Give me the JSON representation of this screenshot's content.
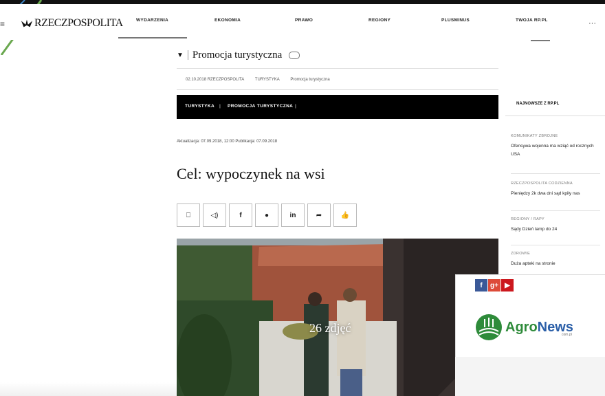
{
  "header": {
    "logo_text": "RZECZPOSPOLITA",
    "nav_items": [
      "WYDARZENIA",
      "EKONOMIA",
      "PRAWO",
      "REGIONY",
      "PLUSMINUS",
      "TWOJA RP.PL"
    ],
    "more_label": "···"
  },
  "article": {
    "section_title": "Promocja turystyczna",
    "breadcrumb": [
      "02.10.2018 RZECZPOSPOLITA",
      "TURYSTYKA",
      "Promocja turystyczna"
    ],
    "category_bar": [
      "TURYSTYKA",
      "PROMOCJA TURYSTYCZNA"
    ],
    "dates": "Aktualizacja: 07.09.2018, 12:00   Publikacja: 07.09.2018",
    "headline": "Cel: wypoczynek na wsi",
    "share_buttons": [
      "bookmark-icon",
      "speaker-icon",
      "facebook-icon",
      "twitter-icon",
      "linkedin-icon",
      "share-arrow-icon",
      "thumbs-up-icon"
    ],
    "photo_caption": "26 zdjęć"
  },
  "sidebar": {
    "heading": "NAJNOWSZE Z RP.PL",
    "items": [
      {
        "category": "KOMUNIKATY ZBROJNE",
        "text": "Ofensywa wojenna ma wziąć od rocznych USA"
      },
      {
        "category": "RZECZPOSPOLITA CODZIENNA",
        "text": "Pieniędzy 2k dwa dni sąd kpiły nas"
      },
      {
        "category": "REGIONY / RAPY",
        "text": "Sądy Dzień lamp do 24"
      },
      {
        "category": "ZDROWIE",
        "text": "Duża apteki na stronie"
      }
    ]
  },
  "ad": {
    "social": [
      "f",
      "g+",
      "▶"
    ],
    "brand_name": "AgroNews",
    "brand_sub": "com.pl",
    "colors": {
      "facebook": "#3b5998",
      "google": "#dd4b39",
      "youtube": "#cc181e",
      "brand_green": "#2e8b3a"
    }
  }
}
